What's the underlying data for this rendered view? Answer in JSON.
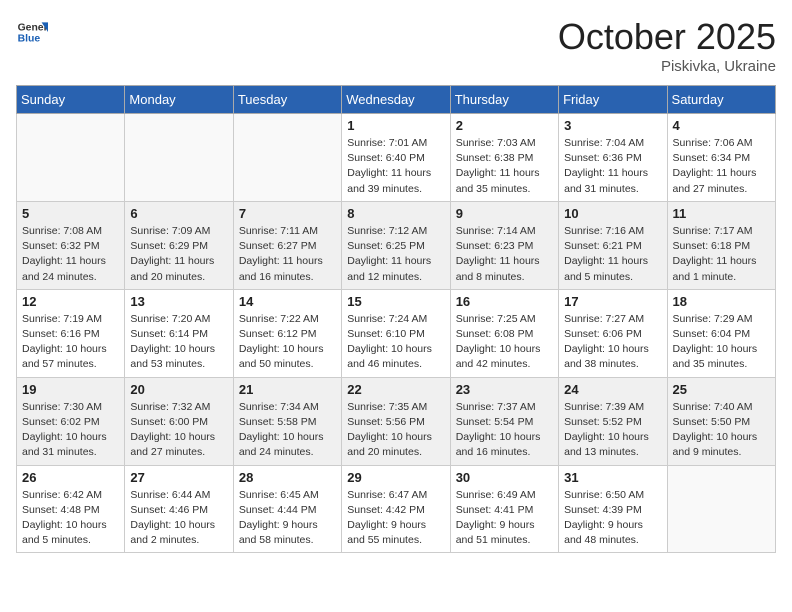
{
  "header": {
    "logo_general": "General",
    "logo_blue": "Blue",
    "month_title": "October 2025",
    "location": "Piskivka, Ukraine"
  },
  "days_of_week": [
    "Sunday",
    "Monday",
    "Tuesday",
    "Wednesday",
    "Thursday",
    "Friday",
    "Saturday"
  ],
  "weeks": [
    [
      {
        "day": "",
        "info": ""
      },
      {
        "day": "",
        "info": ""
      },
      {
        "day": "",
        "info": ""
      },
      {
        "day": "1",
        "info": "Sunrise: 7:01 AM\nSunset: 6:40 PM\nDaylight: 11 hours and 39 minutes."
      },
      {
        "day": "2",
        "info": "Sunrise: 7:03 AM\nSunset: 6:38 PM\nDaylight: 11 hours and 35 minutes."
      },
      {
        "day": "3",
        "info": "Sunrise: 7:04 AM\nSunset: 6:36 PM\nDaylight: 11 hours and 31 minutes."
      },
      {
        "day": "4",
        "info": "Sunrise: 7:06 AM\nSunset: 6:34 PM\nDaylight: 11 hours and 27 minutes."
      }
    ],
    [
      {
        "day": "5",
        "info": "Sunrise: 7:08 AM\nSunset: 6:32 PM\nDaylight: 11 hours and 24 minutes."
      },
      {
        "day": "6",
        "info": "Sunrise: 7:09 AM\nSunset: 6:29 PM\nDaylight: 11 hours and 20 minutes."
      },
      {
        "day": "7",
        "info": "Sunrise: 7:11 AM\nSunset: 6:27 PM\nDaylight: 11 hours and 16 minutes."
      },
      {
        "day": "8",
        "info": "Sunrise: 7:12 AM\nSunset: 6:25 PM\nDaylight: 11 hours and 12 minutes."
      },
      {
        "day": "9",
        "info": "Sunrise: 7:14 AM\nSunset: 6:23 PM\nDaylight: 11 hours and 8 minutes."
      },
      {
        "day": "10",
        "info": "Sunrise: 7:16 AM\nSunset: 6:21 PM\nDaylight: 11 hours and 5 minutes."
      },
      {
        "day": "11",
        "info": "Sunrise: 7:17 AM\nSunset: 6:18 PM\nDaylight: 11 hours and 1 minute."
      }
    ],
    [
      {
        "day": "12",
        "info": "Sunrise: 7:19 AM\nSunset: 6:16 PM\nDaylight: 10 hours and 57 minutes."
      },
      {
        "day": "13",
        "info": "Sunrise: 7:20 AM\nSunset: 6:14 PM\nDaylight: 10 hours and 53 minutes."
      },
      {
        "day": "14",
        "info": "Sunrise: 7:22 AM\nSunset: 6:12 PM\nDaylight: 10 hours and 50 minutes."
      },
      {
        "day": "15",
        "info": "Sunrise: 7:24 AM\nSunset: 6:10 PM\nDaylight: 10 hours and 46 minutes."
      },
      {
        "day": "16",
        "info": "Sunrise: 7:25 AM\nSunset: 6:08 PM\nDaylight: 10 hours and 42 minutes."
      },
      {
        "day": "17",
        "info": "Sunrise: 7:27 AM\nSunset: 6:06 PM\nDaylight: 10 hours and 38 minutes."
      },
      {
        "day": "18",
        "info": "Sunrise: 7:29 AM\nSunset: 6:04 PM\nDaylight: 10 hours and 35 minutes."
      }
    ],
    [
      {
        "day": "19",
        "info": "Sunrise: 7:30 AM\nSunset: 6:02 PM\nDaylight: 10 hours and 31 minutes."
      },
      {
        "day": "20",
        "info": "Sunrise: 7:32 AM\nSunset: 6:00 PM\nDaylight: 10 hours and 27 minutes."
      },
      {
        "day": "21",
        "info": "Sunrise: 7:34 AM\nSunset: 5:58 PM\nDaylight: 10 hours and 24 minutes."
      },
      {
        "day": "22",
        "info": "Sunrise: 7:35 AM\nSunset: 5:56 PM\nDaylight: 10 hours and 20 minutes."
      },
      {
        "day": "23",
        "info": "Sunrise: 7:37 AM\nSunset: 5:54 PM\nDaylight: 10 hours and 16 minutes."
      },
      {
        "day": "24",
        "info": "Sunrise: 7:39 AM\nSunset: 5:52 PM\nDaylight: 10 hours and 13 minutes."
      },
      {
        "day": "25",
        "info": "Sunrise: 7:40 AM\nSunset: 5:50 PM\nDaylight: 10 hours and 9 minutes."
      }
    ],
    [
      {
        "day": "26",
        "info": "Sunrise: 6:42 AM\nSunset: 4:48 PM\nDaylight: 10 hours and 5 minutes."
      },
      {
        "day": "27",
        "info": "Sunrise: 6:44 AM\nSunset: 4:46 PM\nDaylight: 10 hours and 2 minutes."
      },
      {
        "day": "28",
        "info": "Sunrise: 6:45 AM\nSunset: 4:44 PM\nDaylight: 9 hours and 58 minutes."
      },
      {
        "day": "29",
        "info": "Sunrise: 6:47 AM\nSunset: 4:42 PM\nDaylight: 9 hours and 55 minutes."
      },
      {
        "day": "30",
        "info": "Sunrise: 6:49 AM\nSunset: 4:41 PM\nDaylight: 9 hours and 51 minutes."
      },
      {
        "day": "31",
        "info": "Sunrise: 6:50 AM\nSunset: 4:39 PM\nDaylight: 9 hours and 48 minutes."
      },
      {
        "day": "",
        "info": ""
      }
    ]
  ]
}
